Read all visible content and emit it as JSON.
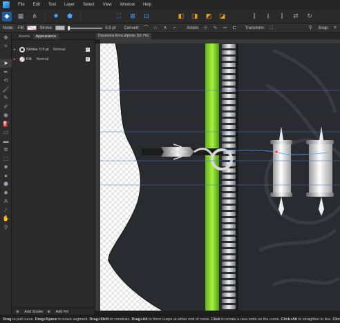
{
  "menubar": {
    "items": [
      "File",
      "Edit",
      "Text",
      "Layer",
      "Select",
      "View",
      "Window",
      "Help"
    ]
  },
  "context_toolbar": {
    "mode_label": "Node:",
    "fill_label": "Fill:",
    "stroke_label": "Stroke:",
    "stroke_width": "0.5 pt",
    "convert_label": "Convert:",
    "action_label": "Action:",
    "transform_label": "Transform:",
    "snap_label": "Snap:"
  },
  "panel": {
    "tabs": [
      "Assets",
      "Appearance"
    ],
    "selected_tab": "Appearance",
    "rows": [
      {
        "label": "Stroke: 0.5 pt",
        "blend": "Normal"
      },
      {
        "label": "Fill:",
        "blend": "Normal"
      }
    ],
    "add_stroke": "Add Stroke",
    "add_fill": "Add Fill"
  },
  "document": {
    "tab_title": "Dissomnia Arms.afphoto (52.7%)"
  },
  "status": {
    "parts": [
      {
        "text": "Drag",
        "bold": true
      },
      {
        "text": " to pull curve. ",
        "bold": false
      },
      {
        "text": "Drag+Space",
        "bold": true
      },
      {
        "text": " to move segment. ",
        "bold": false
      },
      {
        "text": "Drag+Shift",
        "bold": true
      },
      {
        "text": " to constrain. ",
        "bold": false
      },
      {
        "text": "Drag+Alt",
        "bold": true
      },
      {
        "text": " to force cusps at either end of curve. ",
        "bold": false
      },
      {
        "text": "Click",
        "bold": true
      },
      {
        "text": " to create a new node on the curve. ",
        "bold": false
      },
      {
        "text": "Click+Alt",
        "bold": true
      },
      {
        "text": " to straighten to line. ",
        "bold": false
      },
      {
        "text": "Click+Ctrl",
        "bold": true
      }
    ]
  },
  "colors": {
    "accent_green": "#7ed321",
    "guide_blue": "#3c78c8",
    "canvas_bg": "#2b2b33"
  }
}
